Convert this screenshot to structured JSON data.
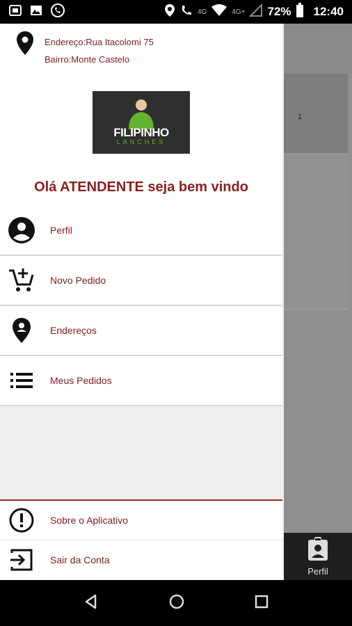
{
  "status_bar": {
    "network_label": "4G",
    "network_label_2": "4G+",
    "battery": "72%",
    "time": "12:40"
  },
  "drawer": {
    "address_line": "Endereço:Rua Itacolomi 75",
    "neighborhood_line": "Bairro:Monte Castelo",
    "logo": {
      "title": "FILIPINHO",
      "subtitle": "LANCHES"
    },
    "welcome": "Olá ATENDENTE seja bem vindo",
    "menu": [
      {
        "label": "Perfil",
        "icon": "account-circle-icon"
      },
      {
        "label": "Novo Pedido",
        "icon": "add-shopping-cart-icon"
      },
      {
        "label": "Endereços",
        "icon": "location-pin-icon"
      },
      {
        "label": "Meus Pedidos",
        "icon": "list-icon"
      }
    ],
    "footer": [
      {
        "label": "Sobre o Aplicativo",
        "icon": "info-exclamation-icon"
      },
      {
        "label": "Sair da Conta",
        "icon": "exit-icon"
      }
    ]
  },
  "background_app": {
    "row_number": "1",
    "bottom_tab_label": "Perfil"
  },
  "colors": {
    "accent": "#8b1e1e",
    "logo_green": "#64b32d"
  }
}
